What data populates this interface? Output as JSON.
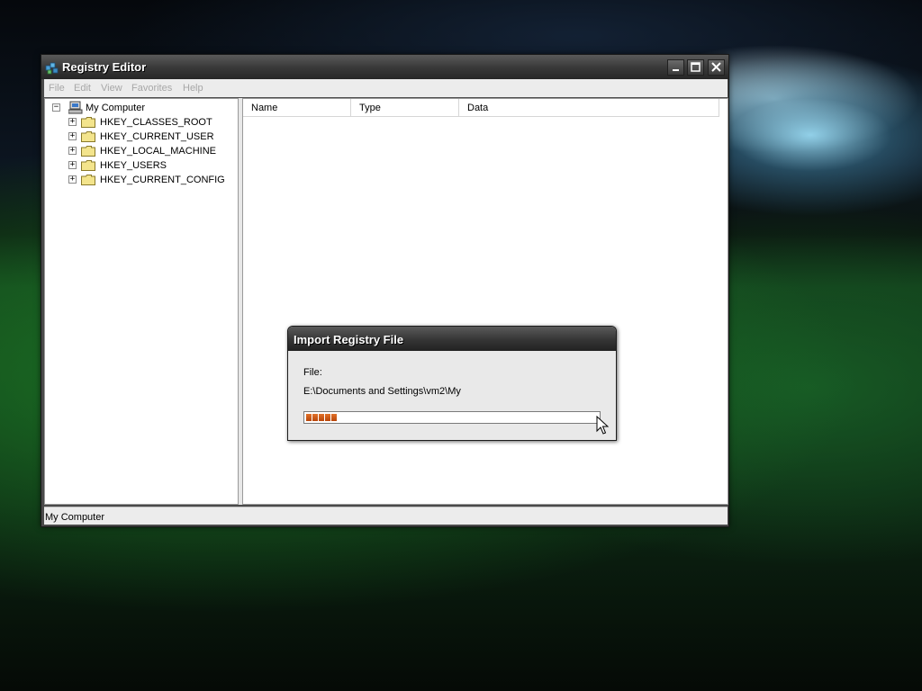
{
  "window": {
    "title": "Registry Editor",
    "controls": [
      "minimize",
      "maximize",
      "close"
    ]
  },
  "menu": [
    "File",
    "Edit",
    "View",
    "Favorites",
    "Help"
  ],
  "tree": {
    "root": "My Computer",
    "hives": [
      "HKEY_CLASSES_ROOT",
      "HKEY_CURRENT_USER",
      "HKEY_LOCAL_MACHINE",
      "HKEY_USERS",
      "HKEY_CURRENT_CONFIG"
    ]
  },
  "columns": [
    "Name",
    "Type",
    "Data"
  ],
  "status": "My Computer",
  "dialog": {
    "title": "Import Registry File",
    "file_label": "File:",
    "file_path": "E:\\Documents and Settings\\vm2\\My",
    "progress_blocks": 5
  },
  "colors": {
    "progress": "#d25f1a",
    "titlebar": "#3a3a3a",
    "menu_disabled": "#a7a7a7"
  }
}
